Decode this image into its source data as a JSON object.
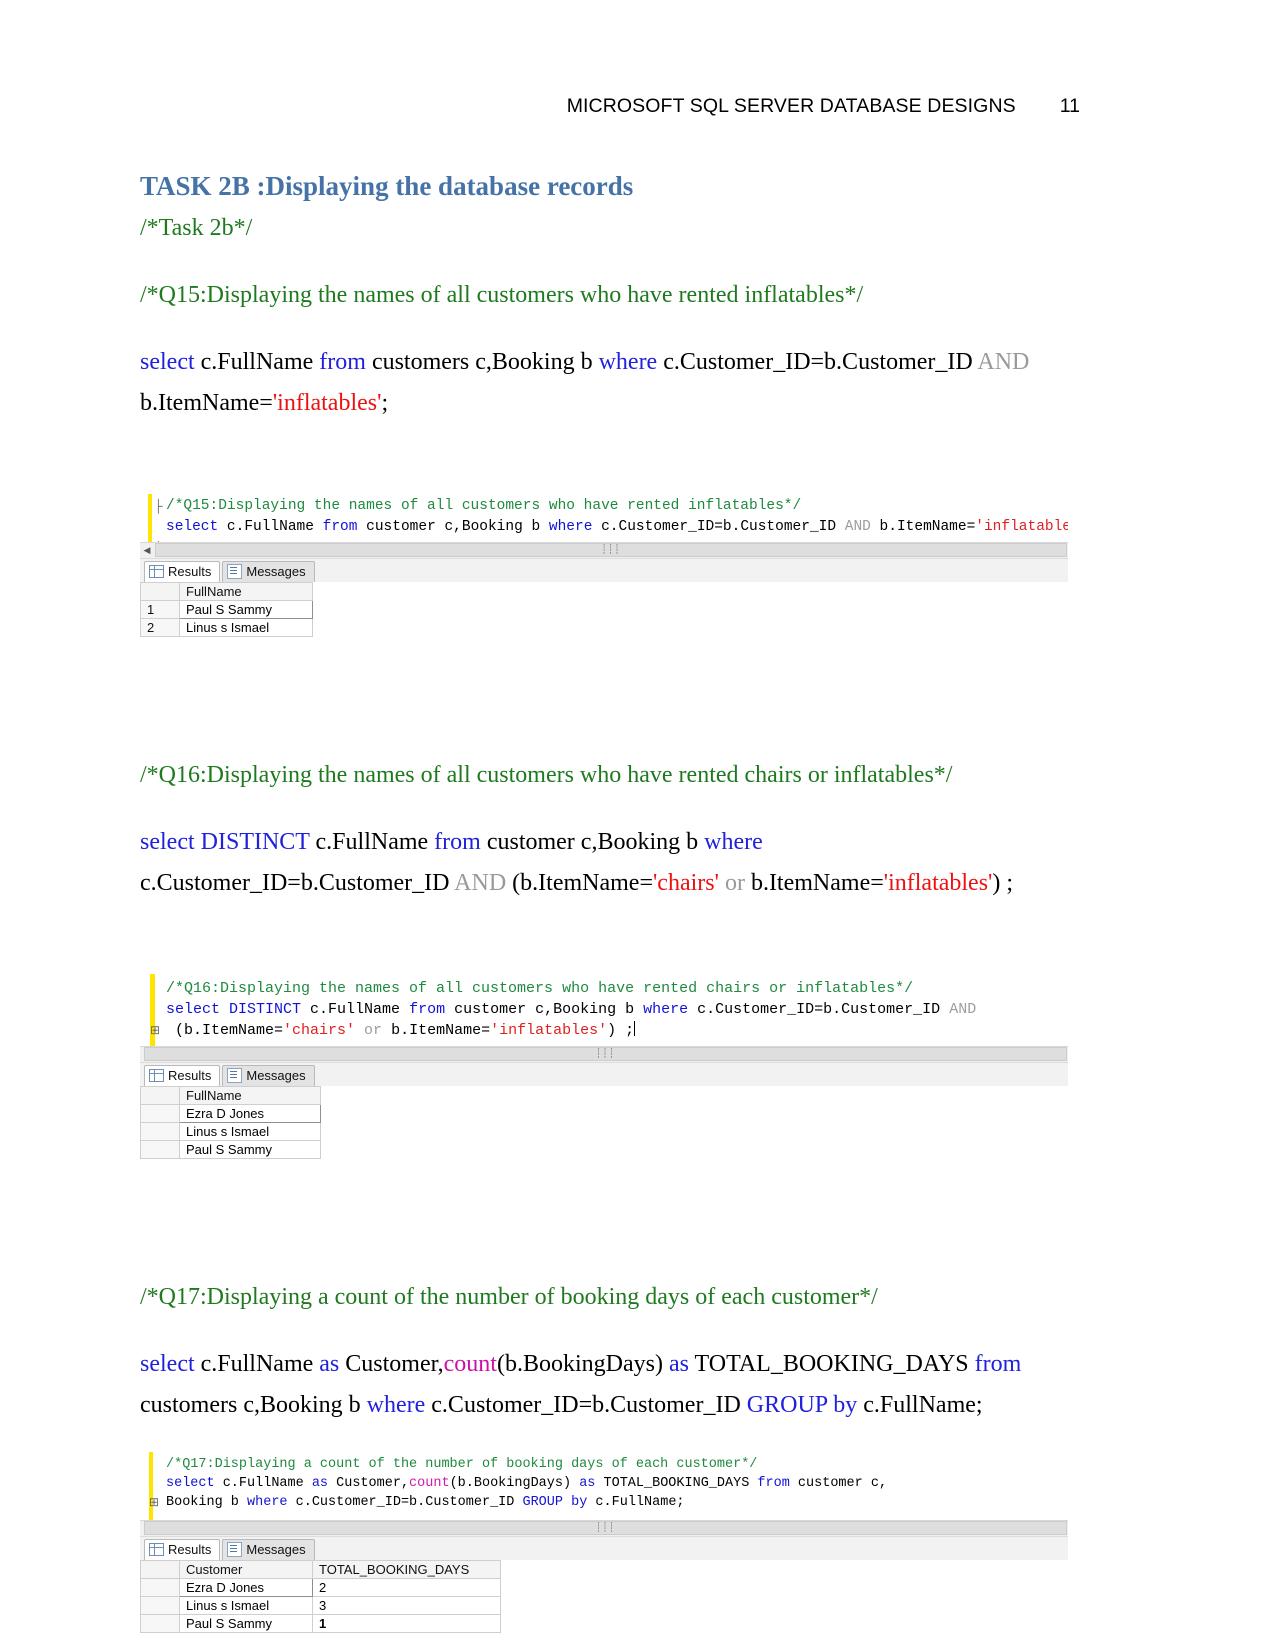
{
  "header": {
    "title": "MICROSOFT SQL SERVER DATABASE DESIGNS",
    "page_number": "11"
  },
  "section": {
    "heading": "TASK 2B :Displaying the database records",
    "task_comment": "/*Task 2b*/"
  },
  "q15": {
    "comment": "/*Q15:Displaying the names of all customers who have rented inflatables*/",
    "sql_line1_kw_select": "select",
    "sql_line1_a": " c.FullName ",
    "sql_line1_kw_from": "from",
    "sql_line1_b": " customers c,Booking b ",
    "sql_line1_kw_where": "where",
    "sql_line1_c": " c.Customer_ID=b.Customer_ID ",
    "sql_line1_kw_and": "AND",
    "sql_line2_a": "b.ItemName=",
    "sql_line2_str": "'inflatables'",
    "sql_line2_b": ";",
    "editor": {
      "line1_comment": "/*Q15:Displaying the names of all customers who have rented inflatables*/",
      "line2_select": "select",
      "line2_t1": " c.FullName ",
      "line2_from": "from",
      "line2_t2": " customer c,Booking b ",
      "line2_where": "where",
      "line2_t3": " c.Customer_ID=b.Customer_ID ",
      "line2_and": "AND",
      "line2_t4": " b.ItemName=",
      "line2_str": "'inflatables'",
      "line2_t5": ";"
    },
    "tabs": {
      "results": "Results",
      "messages": "Messages"
    },
    "grid": {
      "columns": [
        "",
        "FullName"
      ],
      "rows": [
        {
          "num": "1",
          "FullName": "Paul S Sammy"
        },
        {
          "num": "2",
          "FullName": "Linus s Ismael"
        }
      ]
    }
  },
  "q16": {
    "comment": "/*Q16:Displaying the names of all customers who have rented chairs or inflatables*/",
    "sql_line1_kw_select": "select",
    "sql_line1_kw_distinct": "DISTINCT",
    "sql_line1_a": " c.FullName ",
    "sql_line1_kw_from": "from",
    "sql_line1_b": " customer c,Booking b ",
    "sql_line1_kw_where": "where",
    "sql_line2_a": "c.Customer_ID=b.Customer_ID ",
    "sql_line2_and": "AND",
    "sql_line2_b": " (b.ItemName=",
    "sql_line2_str1": "'chairs'",
    "sql_line2_or": " or ",
    "sql_line2_c": "b.ItemName=",
    "sql_line2_str2": "'inflatables'",
    "sql_line2_d": ") ;",
    "editor": {
      "line1_comment": "/*Q16:Displaying the names of all customers who have rented chairs or inflatables*/",
      "line2_select": "select",
      "line2_distinct": " DISTINCT",
      "line2_t1": " c.FullName ",
      "line2_from": "from",
      "line2_t2": " customer c,Booking b ",
      "line2_where": "where",
      "line2_t3": " c.Customer_ID=b.Customer_ID ",
      "line2_and": "AND",
      "line3_t1": " (b.ItemName=",
      "line3_str1": "'chairs'",
      "line3_or": " or ",
      "line3_t2": "b.ItemName=",
      "line3_str2": "'inflatables'",
      "line3_t3": ") ;"
    },
    "tabs": {
      "results": "Results",
      "messages": "Messages"
    },
    "grid": {
      "columns": [
        "",
        "FullName"
      ],
      "rows": [
        {
          "num": "",
          "FullName": "Ezra D Jones"
        },
        {
          "num": "",
          "FullName": "Linus s Ismael"
        },
        {
          "num": "",
          "FullName": "Paul S Sammy"
        }
      ]
    }
  },
  "q17": {
    "comment": "/*Q17:Displaying a count of the number of booking days of each customer*/",
    "sql_line1_kw_select": "select",
    "sql_line1_a": " c.FullName ",
    "sql_line1_kw_as1": "as",
    "sql_line1_b": " Customer,",
    "sql_line1_fn": "count",
    "sql_line1_c": "(b.BookingDays) ",
    "sql_line1_kw_as2": "as",
    "sql_line1_d": " TOTAL_BOOKING_DAYS ",
    "sql_line1_kw_from": "from",
    "sql_line2_a": "customers c,Booking b ",
    "sql_line2_where": "where",
    "sql_line2_b": " c.Customer_ID=b.Customer_ID ",
    "sql_line2_group": "GROUP",
    "sql_line2_c": " by",
    "sql_line2_d": " c.FullName;",
    "editor": {
      "line1_comment": "/*Q17:Displaying a count of the number of booking days of each customer*/",
      "line2_select": "select",
      "line2_t1": " c.FullName ",
      "line2_as1": "as",
      "line2_t2": " Customer,",
      "line2_fn": "count",
      "line2_t3": "(b.BookingDays) ",
      "line2_as2": "as",
      "line2_t4": " TOTAL_BOOKING_DAYS ",
      "line2_from": "from",
      "line2_t5": " customer c,",
      "line3_t1": "Booking b ",
      "line3_where": "where",
      "line3_t2": " c.Customer_ID=b.Customer_ID ",
      "line3_group": "GROUP",
      "line3_by": " by",
      "line3_t3": " c.FullName;"
    },
    "tabs": {
      "results": "Results",
      "messages": "Messages"
    },
    "grid": {
      "columns": [
        "",
        "Customer",
        "TOTAL_BOOKING_DAYS"
      ],
      "rows": [
        {
          "num": "",
          "Customer": "Ezra D Jones",
          "TOTAL_BOOKING_DAYS": "2"
        },
        {
          "num": "",
          "Customer": "Linus s Ismael",
          "TOTAL_BOOKING_DAYS": "3"
        },
        {
          "num": "",
          "Customer": "Paul S Sammy",
          "TOTAL_BOOKING_DAYS": "1"
        }
      ]
    }
  },
  "colors": {
    "heading_blue": "#4572a7",
    "comment_green": "#1f7a1f",
    "keyword_blue": "#2020dd",
    "string_red": "#ee1111",
    "gray_and": "#9a9a9a",
    "function_magenta": "#cc11aa",
    "editor_gutter_yellow": "#ffe400"
  }
}
